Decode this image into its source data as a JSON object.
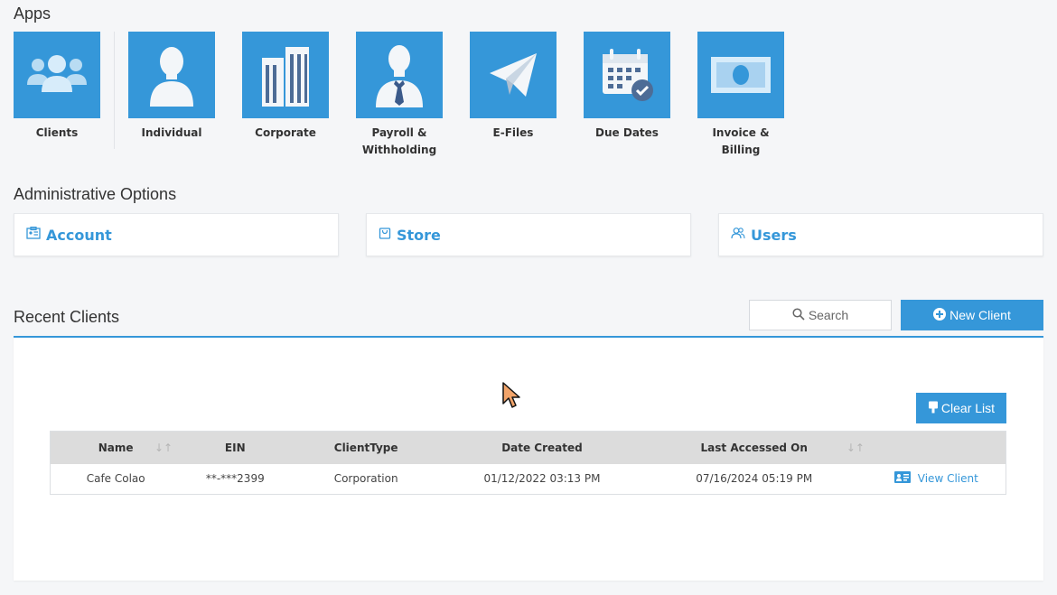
{
  "apps": {
    "title": "Apps",
    "items": [
      {
        "label": "Clients",
        "icon": "users-icon"
      },
      {
        "label": "Individual",
        "icon": "person-icon"
      },
      {
        "label": "Corporate",
        "icon": "buildings-icon"
      },
      {
        "label": "Payroll &\nWithholding",
        "icon": "businessman-icon"
      },
      {
        "label": "E-Files",
        "icon": "paper-plane-icon"
      },
      {
        "label": "Due Dates",
        "icon": "calendar-check-icon"
      },
      {
        "label": "Invoice &\nBilling",
        "icon": "banknote-icon"
      }
    ]
  },
  "admin": {
    "title": "Administrative Options",
    "account_label": "Account",
    "store_label": "Store",
    "users_label": "Users"
  },
  "recent": {
    "title": "Recent Clients",
    "search_label": "Search",
    "new_client_label": "New Client",
    "clear_list_label": "Clear List",
    "columns": [
      "Name",
      "EIN",
      "ClientType",
      "Date Created",
      "Last Accessed On",
      ""
    ],
    "rows": [
      {
        "name": "Cafe Colao",
        "ein": "**-***2399",
        "client_type": "Corporation",
        "date_created": "01/12/2022 03:13 PM",
        "last_accessed": "07/16/2024 05:19 PM",
        "action": "View Client"
      }
    ]
  },
  "colors": {
    "accent": "#3597d9",
    "header_bg": "#dcdcdc",
    "page_bg": "#f5f6f8"
  }
}
